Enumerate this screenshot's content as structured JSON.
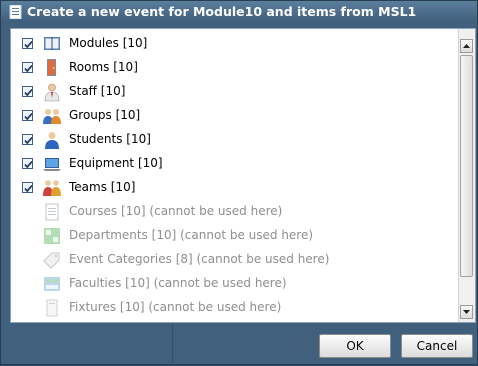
{
  "dialog": {
    "title": "Create a new event for Module10 and items from MSL1",
    "ok_label": "OK",
    "cancel_label": "Cancel"
  },
  "items": [
    {
      "label": "Modules [10]",
      "checked": true,
      "enabled": true,
      "icon": "book-icon"
    },
    {
      "label": "Rooms [10]",
      "checked": true,
      "enabled": true,
      "icon": "door-icon"
    },
    {
      "label": "Staff [10]",
      "checked": true,
      "enabled": true,
      "icon": "person-icon"
    },
    {
      "label": "Groups [10]",
      "checked": true,
      "enabled": true,
      "icon": "group-icon"
    },
    {
      "label": "Students [10]",
      "checked": true,
      "enabled": true,
      "icon": "student-icon"
    },
    {
      "label": "Equipment [10]",
      "checked": true,
      "enabled": true,
      "icon": "laptop-icon"
    },
    {
      "label": "Teams [10]",
      "checked": true,
      "enabled": true,
      "icon": "team-icon"
    },
    {
      "label": "Courses [10] (cannot be used here)",
      "checked": false,
      "enabled": false,
      "icon": "document-icon"
    },
    {
      "label": "Departments [10] (cannot be used here)",
      "checked": false,
      "enabled": false,
      "icon": "department-icon"
    },
    {
      "label": "Event Categories [8] (cannot be used here)",
      "checked": false,
      "enabled": false,
      "icon": "tag-icon"
    },
    {
      "label": "Faculties [10] (cannot be used here)",
      "checked": false,
      "enabled": false,
      "icon": "faculty-icon"
    },
    {
      "label": "Fixtures [10] (cannot be used here)",
      "checked": false,
      "enabled": false,
      "icon": "fixture-icon"
    }
  ]
}
